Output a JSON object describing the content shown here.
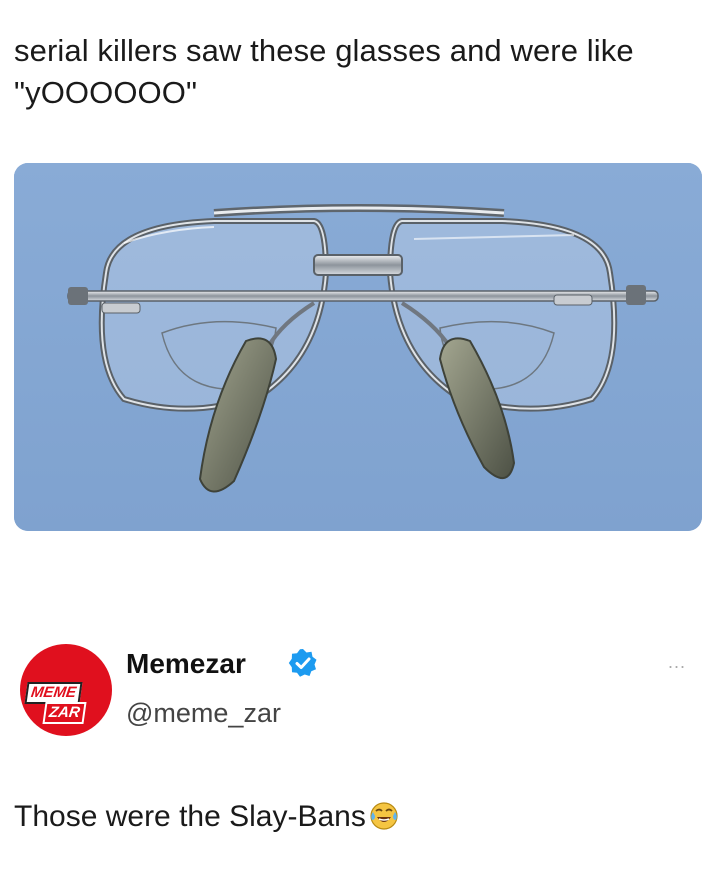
{
  "post": {
    "caption": "serial killers saw these glasses and were like \"yOOOOOO\"",
    "image_icon": "aviator-eyeglasses-photo"
  },
  "author": {
    "name": "Memezar",
    "handle": "@meme_zar",
    "verified": true,
    "avatar_text_top": "MEME",
    "avatar_text_bottom": "ZAR",
    "more_label": "...",
    "accent_color": "#e0101e",
    "verified_color": "#1d9bf0"
  },
  "tweet": {
    "text": "Those were the Slay-Bans",
    "emoji_icon": "crying-laughing-emoji"
  }
}
